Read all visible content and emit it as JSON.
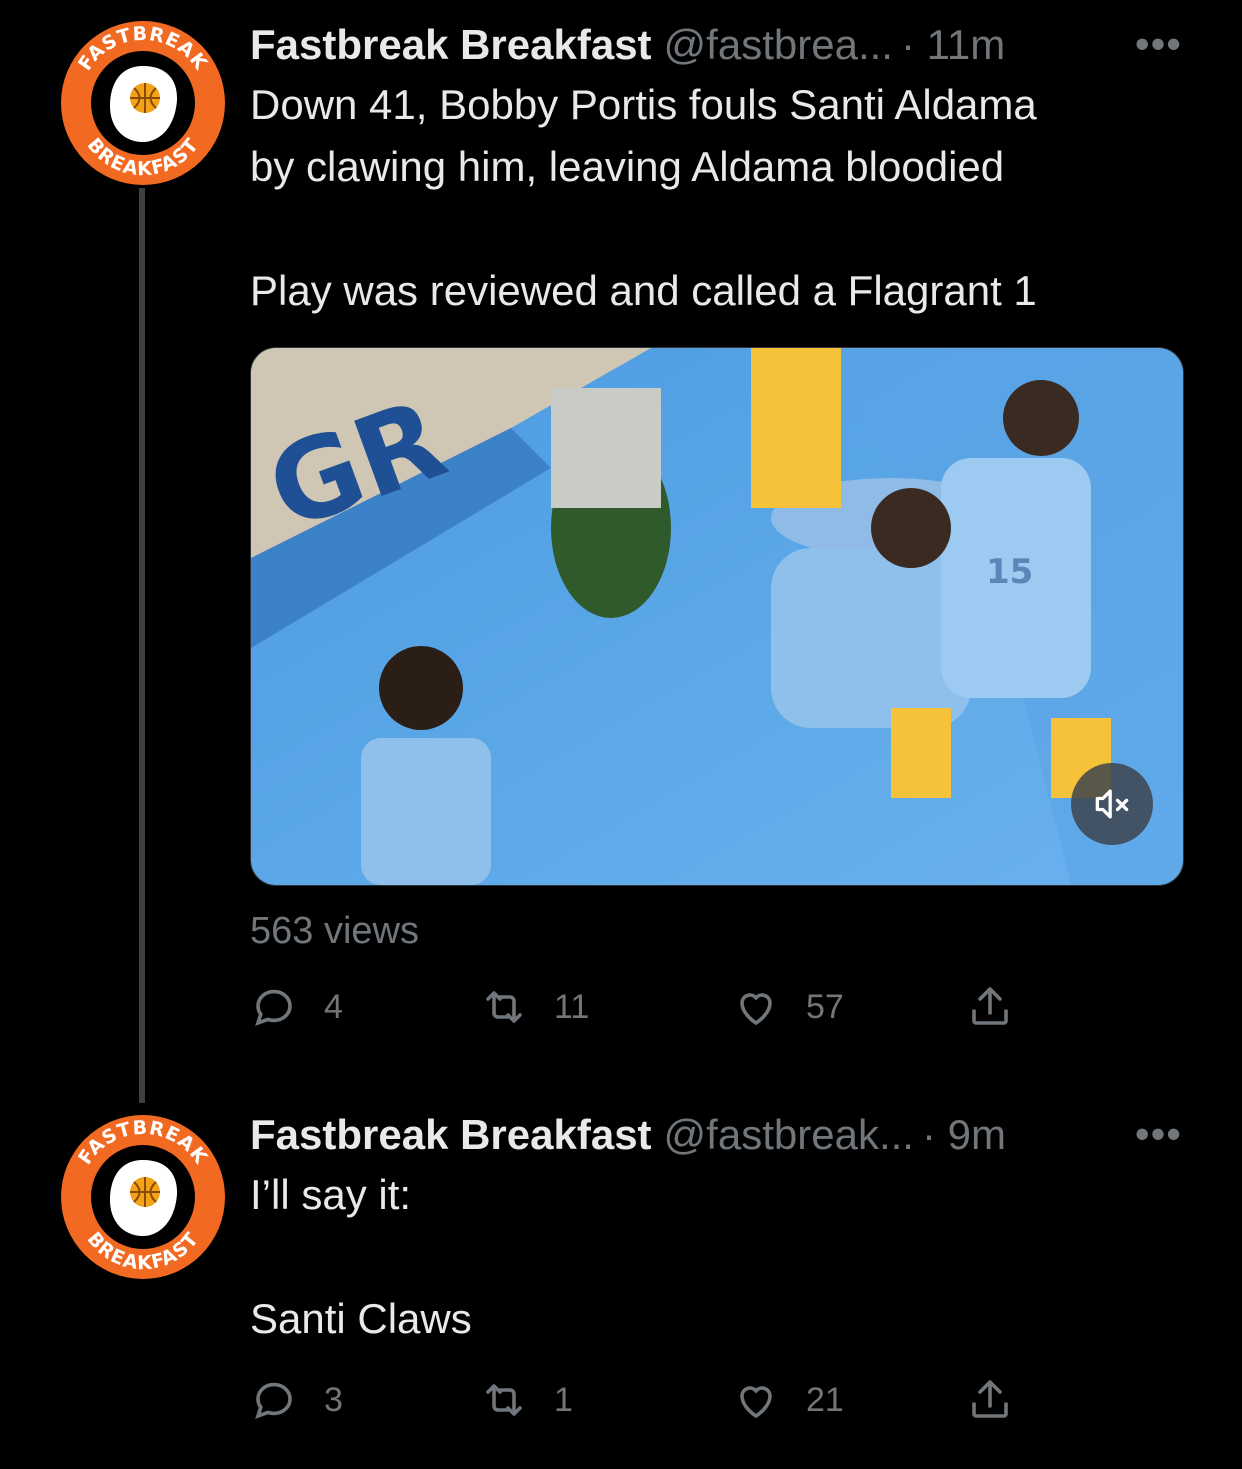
{
  "tweets": [
    {
      "name": "Fastbreak Breakfast",
      "handle": "@fastbrea...",
      "time": "· 11m",
      "text": "Down 41, Bobby Portis fouls Santi Aldama\nby clawing him, leaving Aldama bloodied\n\nPlay was reviewed and called a Flagrant 1",
      "views": "563 views",
      "replies": "4",
      "retweets": "11",
      "likes": "57"
    },
    {
      "name": "Fastbreak Breakfast",
      "handle": "@fastbreak...",
      "time": "· 9m",
      "text": "I’ll say it:\n\nSanti Claws",
      "replies": "3",
      "retweets": "1",
      "likes": "21"
    }
  ],
  "avatar": {
    "top_text": "FASTBREAK",
    "bottom_text": "BREAKFAST",
    "color": "#f26a21"
  },
  "media": {
    "court_letters": "GR",
    "jersey_number": "15",
    "alt": "video-thumbnail"
  },
  "icons": {
    "more": "more-icon",
    "reply": "reply-icon",
    "retweet": "retweet-icon",
    "like": "heart-icon",
    "share": "share-icon",
    "mute": "mute-icon"
  },
  "more_label": "•••",
  "colors": {
    "bg": "#000000",
    "text": "#e7e9ea",
    "muted": "#71767b",
    "thread": "#3e4144"
  }
}
